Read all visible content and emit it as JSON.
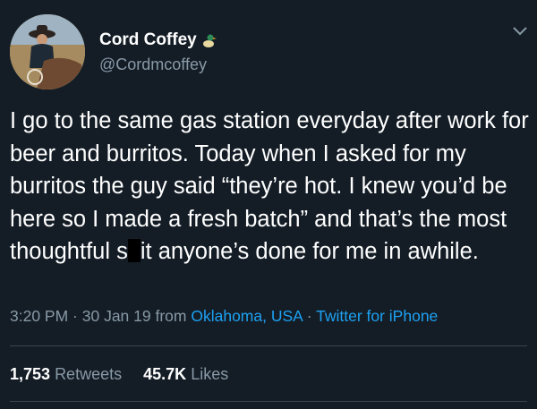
{
  "user": {
    "name": "Cord Coffey",
    "handle": "@Cordmcoffey",
    "badge_icon": "duck-icon"
  },
  "tweet": {
    "text_before_censor": "I go to the same gas station everyday after work for beer and burritos. Today when I asked for my burritos the guy said “they’re hot. I knew you’d be here so I made a fresh batch” and that’s the most thoughtful s",
    "text_after_censor": "it anyone’s done for me in awhile."
  },
  "meta": {
    "time": "3:20 PM",
    "sep1": " · ",
    "date": "30 Jan 19",
    "from": " from ",
    "location": "Oklahoma, USA",
    "sep2": " · ",
    "source": "Twitter for iPhone"
  },
  "stats": {
    "retweets_count": "1,753",
    "retweets_label": "Retweets",
    "likes_count": "45.7K",
    "likes_label": "Likes"
  },
  "colors": {
    "background": "#141d26",
    "secondary_text": "#8899a6",
    "link": "#1da1f2"
  }
}
